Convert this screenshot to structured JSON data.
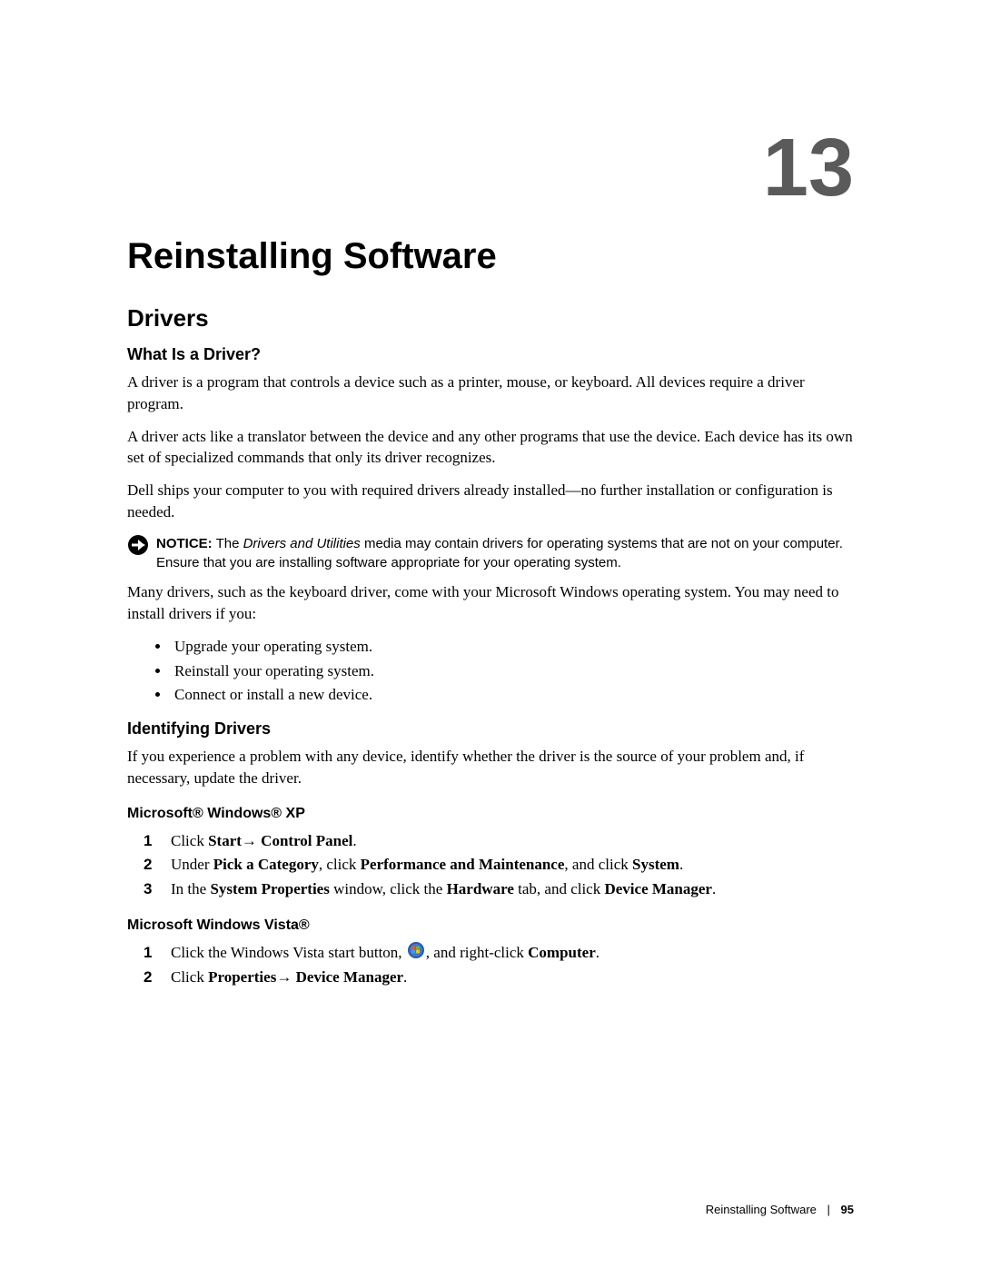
{
  "chapter_number": "13",
  "chapter_title": "Reinstalling Software",
  "section_title": "Drivers",
  "subsection1": {
    "title": "What Is a Driver?",
    "p1": "A driver is a program that controls a device such as a printer, mouse, or keyboard. All devices require a driver program.",
    "p2": "A driver acts like a translator between the device and any other programs that use the device. Each device has its own set of specialized commands that only its driver recognizes.",
    "p3": "Dell ships your computer to you with required drivers already installed—no further installation or configuration is needed.",
    "notice": {
      "label": "NOTICE:",
      "before_italic": " The ",
      "italic": "Drivers and Utilities",
      "after_italic": " media may contain drivers for operating systems that are not on your computer. Ensure that you are installing software appropriate for your operating system."
    },
    "p4": "Many drivers, such as the keyboard driver, come with your Microsoft Windows operating system. You may need to install drivers if you:",
    "bullets": [
      "Upgrade your operating system.",
      "Reinstall your operating system.",
      "Connect or install a new device."
    ]
  },
  "subsection2": {
    "title": "Identifying Drivers",
    "p1": "If you experience a problem with any device, identify whether the driver is the source of your problem and, if necessary, update the driver.",
    "xp": {
      "title": "Microsoft® Windows® XP",
      "steps": {
        "s1": {
          "t1": "Click ",
          "b1": "Start",
          "arrow1": "→ ",
          "b2": "Control Panel",
          "t2": "."
        },
        "s2": {
          "t1": "Under ",
          "b1": "Pick a Category",
          "t2": ", click ",
          "b2": "Performance and Maintenance",
          "t3": ", and click ",
          "b3": "System",
          "t4": "."
        },
        "s3": {
          "t1": "In the ",
          "b1": "System Properties",
          "t2": " window, click the ",
          "b2": "Hardware",
          "t3": " tab, and click ",
          "b3": "Device Manager",
          "t4": "."
        }
      }
    },
    "vista": {
      "title": "Microsoft Windows Vista®",
      "steps": {
        "s1": {
          "t1": "Click the Windows Vista start button, ",
          "t2": ", and right-click ",
          "b1": "Computer",
          "t3": "."
        },
        "s2": {
          "t1": "Click ",
          "b1": "Properties",
          "arrow1": "→ ",
          "b2": "Device Manager",
          "t2": "."
        }
      }
    }
  },
  "footer": {
    "title": "Reinstalling Software",
    "page": "95"
  }
}
